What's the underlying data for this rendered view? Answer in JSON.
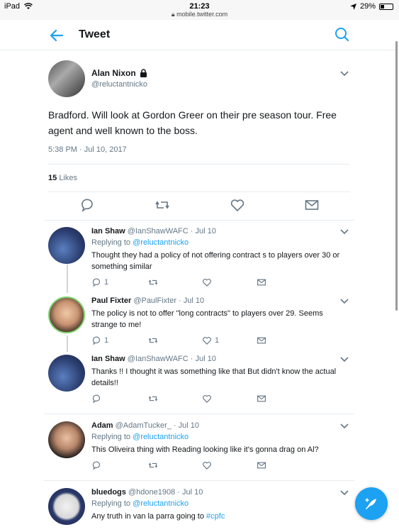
{
  "status_bar": {
    "device": "iPad",
    "time": "21:23",
    "url": "mobile.twitter.com",
    "battery": "29%"
  },
  "header": {
    "title": "Tweet"
  },
  "main_tweet": {
    "name": "Alan Nixon",
    "handle": "@reluctantnicko",
    "text": "Bradford. Will look at Gordon Greer on their pre season tour. Free agent and well known to the boss.",
    "date": "5:38 PM · Jul 10, 2017",
    "likes_count": "15",
    "likes_label": "Likes"
  },
  "replies": [
    {
      "name": "Ian Shaw",
      "handle": "@IanShawWAFC",
      "date": "· Jul 10",
      "replying_prefix": "Replying to",
      "replying_to": "@reluctantnicko",
      "text": "Thought they had a policy of not offering contract s to players over 30 or something similar",
      "reply_count": "1",
      "retweet_count": "",
      "like_count": ""
    },
    {
      "name": "Paul Fixter",
      "handle": "@PaulFixter",
      "date": "· Jul 10",
      "text": "The policy is not to offer \"long contracts\" to players over 29. Seems strange to me!",
      "reply_count": "1",
      "retweet_count": "",
      "like_count": "1"
    },
    {
      "name": "Ian Shaw",
      "handle": "@IanShawWAFC",
      "date": "· Jul 10",
      "text": "Thanks !! I thought it was something like that But didn't know the actual details!!",
      "reply_count": "",
      "retweet_count": "",
      "like_count": ""
    },
    {
      "name": "Adam",
      "handle": "@AdamTucker_",
      "date": "· Jul 10",
      "replying_prefix": "Replying to",
      "replying_to": "@reluctantnicko",
      "text": "This Oliveira thing with Reading looking like it's gonna drag on Al?",
      "reply_count": "",
      "retweet_count": "",
      "like_count": ""
    },
    {
      "name": "bluedogs",
      "handle": "@hdone1908",
      "date": "· Jul 10",
      "replying_prefix": "Replying to",
      "replying_to": "@reluctantnicko",
      "text": "Any truth in van la parra going to ",
      "hashtag": "#cpfc"
    }
  ],
  "icons": {
    "accent": "#1da1f2",
    "muted": "#657786"
  }
}
